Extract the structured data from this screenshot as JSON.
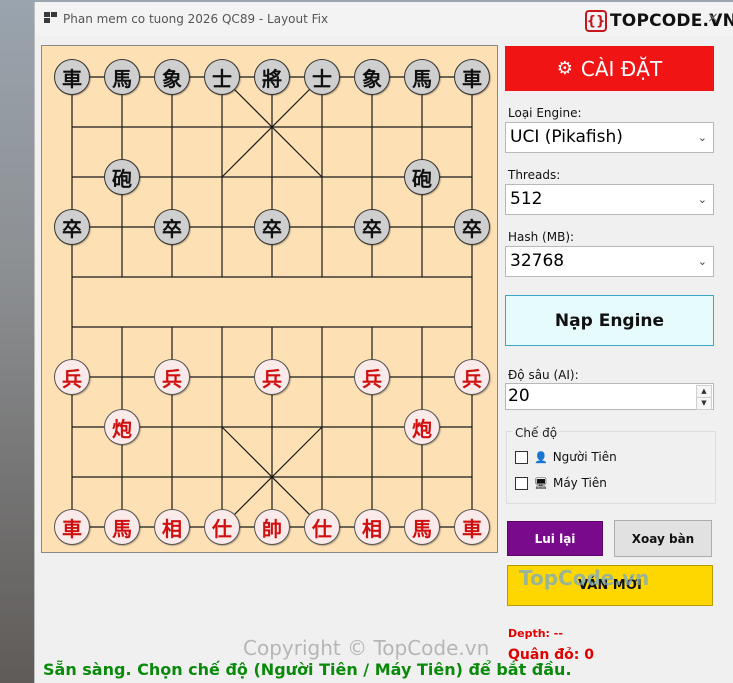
{
  "window": {
    "title": "Phan mem co tuong 2026 QC89 - Layout Fix",
    "logo_text_prefix": "TOP",
    "logo_text_suffix": "CODE.VN",
    "logo_mark": "{}",
    "close_label": "×"
  },
  "board": {
    "colors": {
      "background": "#fde0b3",
      "line": "#1a1a1a",
      "red_piece": "#d01010",
      "black_piece": "#111111"
    },
    "black_pieces": [
      {
        "char": "車",
        "col": 0,
        "row": 0
      },
      {
        "char": "馬",
        "col": 1,
        "row": 0
      },
      {
        "char": "象",
        "col": 2,
        "row": 0
      },
      {
        "char": "士",
        "col": 3,
        "row": 0
      },
      {
        "char": "將",
        "col": 4,
        "row": 0
      },
      {
        "char": "士",
        "col": 5,
        "row": 0
      },
      {
        "char": "象",
        "col": 6,
        "row": 0
      },
      {
        "char": "馬",
        "col": 7,
        "row": 0
      },
      {
        "char": "車",
        "col": 8,
        "row": 0
      },
      {
        "char": "砲",
        "col": 1,
        "row": 2
      },
      {
        "char": "砲",
        "col": 7,
        "row": 2
      },
      {
        "char": "卒",
        "col": 0,
        "row": 3
      },
      {
        "char": "卒",
        "col": 2,
        "row": 3
      },
      {
        "char": "卒",
        "col": 4,
        "row": 3
      },
      {
        "char": "卒",
        "col": 6,
        "row": 3
      },
      {
        "char": "卒",
        "col": 8,
        "row": 3
      }
    ],
    "red_pieces": [
      {
        "char": "兵",
        "col": 0,
        "row": 6
      },
      {
        "char": "兵",
        "col": 2,
        "row": 6
      },
      {
        "char": "兵",
        "col": 4,
        "row": 6
      },
      {
        "char": "兵",
        "col": 6,
        "row": 6
      },
      {
        "char": "兵",
        "col": 8,
        "row": 6
      },
      {
        "char": "炮",
        "col": 1,
        "row": 7
      },
      {
        "char": "炮",
        "col": 7,
        "row": 7
      },
      {
        "char": "車",
        "col": 0,
        "row": 9
      },
      {
        "char": "馬",
        "col": 1,
        "row": 9
      },
      {
        "char": "相",
        "col": 2,
        "row": 9
      },
      {
        "char": "仕",
        "col": 3,
        "row": 9
      },
      {
        "char": "帥",
        "col": 4,
        "row": 9
      },
      {
        "char": "仕",
        "col": 5,
        "row": 9
      },
      {
        "char": "相",
        "col": 6,
        "row": 9
      },
      {
        "char": "馬",
        "col": 7,
        "row": 9
      },
      {
        "char": "車",
        "col": 8,
        "row": 9
      }
    ]
  },
  "settings": {
    "cai_dat_label": "CÀI ĐẶT",
    "engine_type_label": "Loại Engine:",
    "engine_type_value": "UCI (Pikafish)",
    "threads_label": "Threads:",
    "threads_value": "512",
    "hash_label": "Hash (MB):",
    "hash_value": "32768",
    "load_engine_label": "Nạp Engine",
    "depth_label": "Độ sâu (AI):",
    "depth_value": "20"
  },
  "mode": {
    "title": "Chế độ",
    "option_human": "Người Tiên",
    "option_machine": "Máy Tiên",
    "human_checked": false,
    "machine_checked": false
  },
  "actions": {
    "undo_label": "Lui lại",
    "rotate_label": "Xoay bàn",
    "new_game_label": "VÁN MỚI"
  },
  "info": {
    "depth_text": "Depth: --",
    "captured_text": "Quân đỏ: 0"
  },
  "status_text": "Sẵn sàng. Chọn chế độ (Người Tiên / Máy Tiên) để bắt đầu.",
  "watermarks": {
    "topcode": "TopCode.vn",
    "copyright": "Copyright © TopCode.vn"
  }
}
